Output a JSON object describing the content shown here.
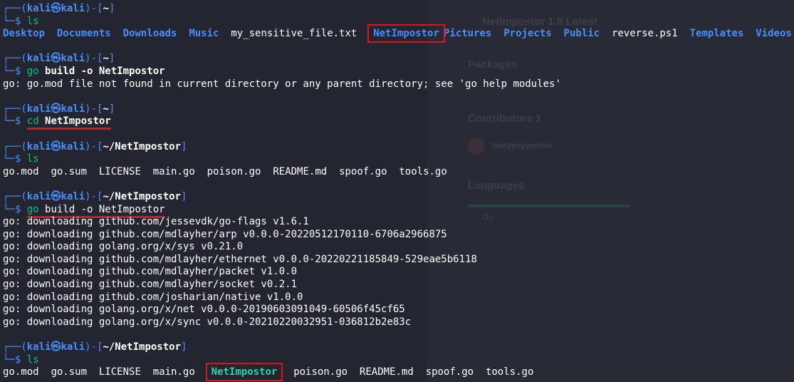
{
  "prompt": {
    "user": "kali",
    "at": "㉿",
    "host": "kali",
    "top_prefix": "┌──(",
    "top_mid": ")-[",
    "top_suffix": "]",
    "bottom": "└─$ "
  },
  "blocks": [
    {
      "path": "~",
      "command": "ls",
      "listing": [
        "Desktop",
        "Documents",
        "Downloads",
        "Music",
        "my_sensitive_file.txt",
        "NetImpostor",
        "Pictures",
        "Projects",
        "Public",
        "reverse.ps1",
        "Templates",
        "Videos"
      ]
    },
    {
      "path": "~",
      "command": "go",
      "args": "build -o NetImpostor",
      "output": "go: go.mod file not found in current directory or any parent directory; see 'go help modules'"
    },
    {
      "path": "~",
      "command": "cd",
      "args": "NetImpostor"
    },
    {
      "path": "~/NetImpostor",
      "command": "ls",
      "listing": [
        "go.mod",
        "go.sum",
        "LICENSE",
        "main.go",
        "poison.go",
        "README.md",
        "spoof.go",
        "tools.go"
      ]
    },
    {
      "path": "~/NetImpostor",
      "command": "go",
      "args": "build -o NetImpostor",
      "output_lines": [
        "go: downloading github.com/jessevdk/go-flags v1.6.1",
        "go: downloading github.com/mdlayher/arp v0.0.0-20220512170110-6706a2966875",
        "go: downloading golang.org/x/sys v0.21.0",
        "go: downloading github.com/mdlayher/ethernet v0.0.0-20220221185849-529eae5b6118",
        "go: downloading github.com/mdlayher/packet v1.0.0",
        "go: downloading github.com/mdlayher/socket v0.2.1",
        "go: downloading github.com/josharian/native v1.0.0",
        "go: downloading golang.org/x/net v0.0.0-20190603091049-60506f45cf65",
        "go: downloading golang.org/x/sync v0.0.0-20210220032951-036812b2e83c"
      ]
    },
    {
      "path": "~/NetImpostor",
      "command": "ls",
      "listing": [
        "go.mod",
        "go.sum",
        "LICENSE",
        "main.go",
        "NetImpostor",
        "poison.go",
        "README.md",
        "spoof.go",
        "tools.go"
      ]
    }
  ],
  "background_page": {
    "packages": "Packages",
    "contributors": "Contributors",
    "contributor_count": "1",
    "contributor_name": "tastypepperoni",
    "languages": "Languages",
    "language_go": "Go",
    "release": "NetImpostor 1.0",
    "release_tag": "Latest"
  },
  "colors": {
    "background": "#232631",
    "prompt_blue": "#4a8dfb",
    "command_green": "#00c38a",
    "directory_blue": "#4a8dfb",
    "executable_cyan": "#2ed3a6",
    "highlight_red": "#e01414"
  }
}
